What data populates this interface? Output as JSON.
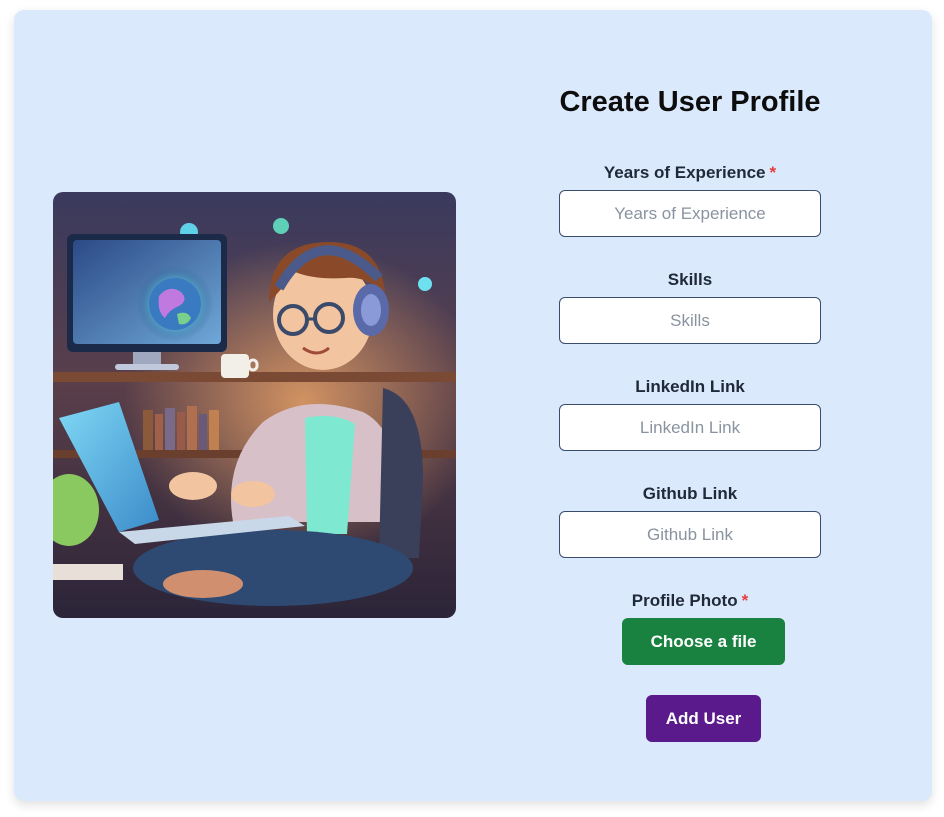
{
  "form": {
    "title": "Create User Profile",
    "required_marker": "*",
    "fields": [
      {
        "label": "Years of Experience",
        "placeholder": "Years of Experience",
        "value": "",
        "required": true
      },
      {
        "label": "Skills",
        "placeholder": "Skills",
        "value": "",
        "required": false
      },
      {
        "label": "LinkedIn Link",
        "placeholder": "LinkedIn Link",
        "value": "",
        "required": false
      },
      {
        "label": "Github Link",
        "placeholder": "Github Link",
        "value": "",
        "required": false
      }
    ],
    "photo": {
      "label": "Profile Photo",
      "button_label": "Choose a file",
      "required": true
    },
    "submit_label": "Add User"
  },
  "colors": {
    "card_background": "#dbe9fd",
    "file_button": "#1a8240",
    "submit_button": "#5b1a8c",
    "required_marker": "#e53e3e"
  },
  "illustration": {
    "icon": "developer-with-laptop-illustration"
  }
}
